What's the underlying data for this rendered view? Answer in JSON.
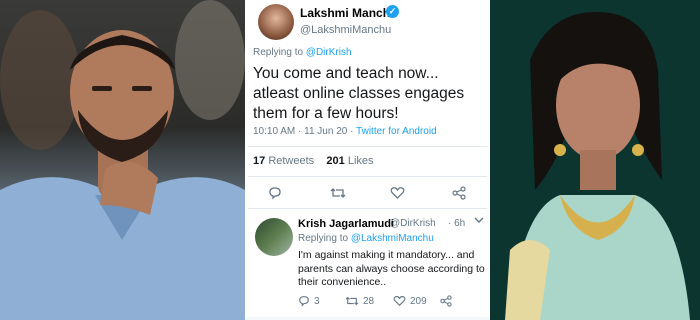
{
  "tweet": {
    "name": "Lakshmi Manchu",
    "handle": "@LakshmiManchu",
    "replying_prefix": "Replying to",
    "replying_to": "@DirKrish",
    "text": "You come and teach now... atleast online classes engages them for a few hours!",
    "time_date": "10:10 AM · 11 Jun 20 ·",
    "source": "Twitter for Android",
    "retweets": "17",
    "retweets_label": "Retweets",
    "likes": "201",
    "likes_label": "Likes"
  },
  "reply": {
    "name": "Krish Jagarlamudi",
    "handle": "@DirKrish",
    "time": "· 6h",
    "replying_prefix": "Replying to",
    "replying_to": "@LakshmiManchu",
    "text": "I'm against making it mandatory... and parents can always choose according to their convenience..",
    "replies": "3",
    "retweets": "28",
    "likes": "209"
  },
  "icons": {
    "verified": "verified-badge",
    "reply": "reply-icon",
    "retweet": "retweet-icon",
    "like": "heart-icon",
    "share": "share-icon",
    "more": "chevron-down-icon"
  },
  "colors": {
    "accent": "#1da1f2",
    "muted": "#657786",
    "text": "#14171a"
  }
}
